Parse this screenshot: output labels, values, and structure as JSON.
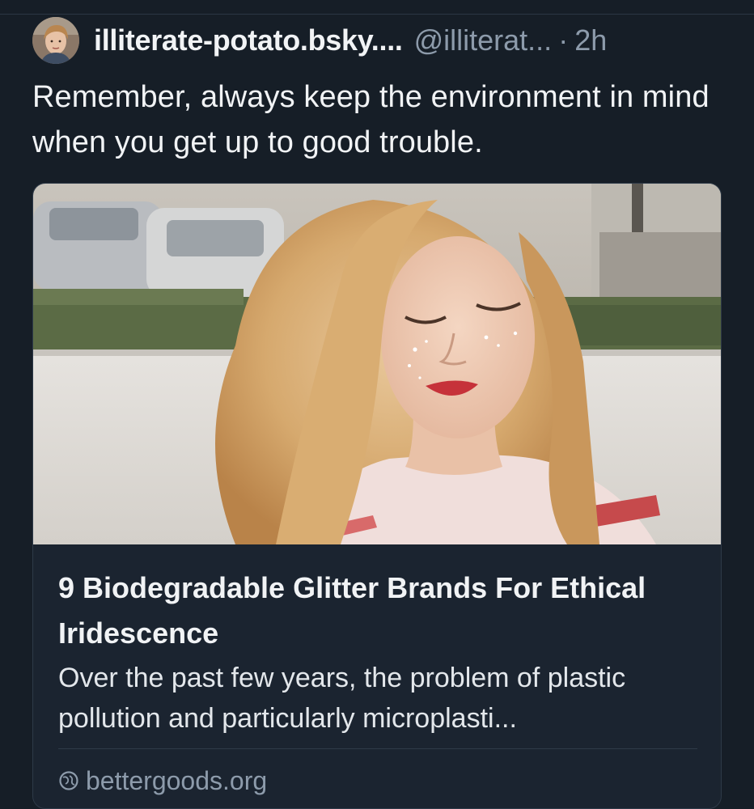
{
  "post": {
    "display_name": "illiterate-potato.bsky....",
    "handle": "@illiterat...",
    "separator": "·",
    "timestamp": "2h",
    "text": "Remember, always keep the environment in mind when you get up to good trouble."
  },
  "link_card": {
    "title": "9 Biodegradable Glitter Brands For Ethical Iridescence",
    "description": "Over the past few years, the problem of plastic pollution and particularly microplasti...",
    "domain": "bettergoods.org",
    "domain_icon": "globe-icon"
  },
  "colors": {
    "background": "#161e27",
    "primary_text": "#f1f3f5",
    "secondary_text": "#8d9bab",
    "card_border": "#2e3a48"
  }
}
